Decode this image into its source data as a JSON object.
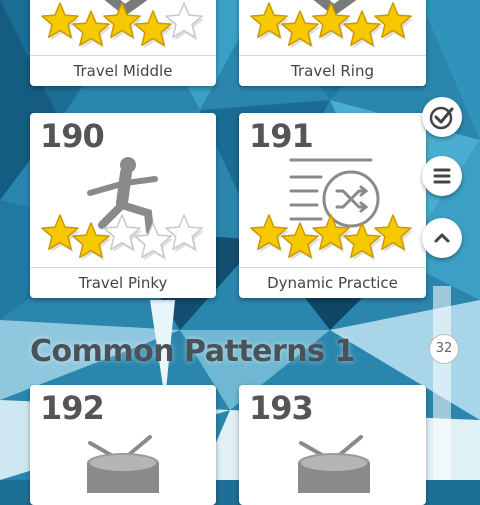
{
  "levels": [
    {
      "number": "",
      "label": "Travel Middle",
      "stars_earned": 4,
      "stars_total": 5,
      "icon": "yoga-pose-icon"
    },
    {
      "number": "",
      "label": "Travel Ring",
      "stars_earned": 5,
      "stars_total": 5,
      "icon": "yoga-pose-icon"
    },
    {
      "number": "190",
      "label": "Travel Pinky",
      "stars_earned": 2,
      "stars_total": 5,
      "icon": "warrior-pose-icon"
    },
    {
      "number": "191",
      "label": "Dynamic Practice",
      "stars_earned": 5,
      "stars_total": 5,
      "icon": "shuffle-list-icon"
    },
    {
      "number": "192",
      "label": "",
      "stars_earned": 0,
      "stars_total": 0,
      "icon": "drum-icon"
    },
    {
      "number": "193",
      "label": "",
      "stars_earned": 0,
      "stars_total": 0,
      "icon": "drum-icon"
    }
  ],
  "section": {
    "title": "Common Patterns 1"
  },
  "side_buttons": [
    "check-circle-icon",
    "menu-icon",
    "chevron-up-icon"
  ],
  "scroll": {
    "badge": "32"
  },
  "colors": {
    "star_gold": "#f5c800",
    "star_empty": "#ffffff",
    "text": "#555555"
  }
}
